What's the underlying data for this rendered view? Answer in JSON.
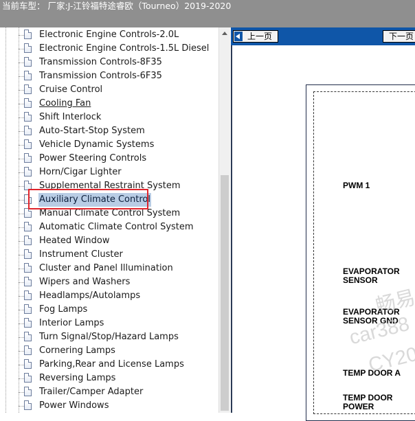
{
  "window": {
    "title": "当前车型：  厂家:J-江铃福特途睿欧（Tourneo）2019-2020"
  },
  "tree": {
    "items": [
      {
        "label": "Electronic Engine Controls-2.0L",
        "state": "normal"
      },
      {
        "label": "Electronic Engine Controls-1.5L Diesel",
        "state": "normal"
      },
      {
        "label": "Transmission Controls-8F35",
        "state": "normal"
      },
      {
        "label": "Transmission Controls-6F35",
        "state": "normal"
      },
      {
        "label": "Cruise Control",
        "state": "normal"
      },
      {
        "label": "Cooling Fan",
        "state": "underline"
      },
      {
        "label": "Shift Interlock",
        "state": "normal"
      },
      {
        "label": "Auto-Start-Stop System",
        "state": "normal"
      },
      {
        "label": "Vehicle Dynamic Systems",
        "state": "normal"
      },
      {
        "label": "Power Steering Controls",
        "state": "normal"
      },
      {
        "label": "Horn/Cigar Lighter",
        "state": "normal"
      },
      {
        "label": "Supplemental Restraint System",
        "state": "normal"
      },
      {
        "label": "Auxiliary Climate Control",
        "state": "selected"
      },
      {
        "label": "Manual Climate Control System",
        "state": "normal"
      },
      {
        "label": "Automatic Climate Control System",
        "state": "normal"
      },
      {
        "label": "Heated Window",
        "state": "normal"
      },
      {
        "label": "Instrument Cluster",
        "state": "normal"
      },
      {
        "label": "Cluster and Panel Illumination",
        "state": "normal"
      },
      {
        "label": "Wipers and Washers",
        "state": "normal"
      },
      {
        "label": "Headlamps/Autolamps",
        "state": "normal"
      },
      {
        "label": "Fog Lamps",
        "state": "normal"
      },
      {
        "label": "Interior Lamps",
        "state": "normal"
      },
      {
        "label": "Turn Signal/Stop/Hazard Lamps",
        "state": "normal"
      },
      {
        "label": "Cornering Lamps",
        "state": "normal"
      },
      {
        "label": "Parking,Rear and License Lamps",
        "state": "normal"
      },
      {
        "label": "Reversing Lamps",
        "state": "normal"
      },
      {
        "label": "Trailer/Camper Adapter",
        "state": "normal"
      },
      {
        "label": "Power Windows",
        "state": "normal"
      }
    ],
    "icon": "document-icon"
  },
  "viewer": {
    "prev_label": "上一页",
    "next_label": "下一页",
    "prev_icon": "arrow-left-icon"
  },
  "diagram": {
    "labels": {
      "pwm1": "PWM 1",
      "evap_sensor": "EVAPORATOR\nSENSOR",
      "evap_sensor_gnd": "EVAPORATOR\nSENSOR GND",
      "temp_door_a": "TEMP DOOR A",
      "temp_door_power": "TEMP DOOR\nPOWER"
    },
    "watermark": {
      "line1": "畅易",
      "line2": "car388",
      "line3": "CY20"
    }
  },
  "colors": {
    "titlebar": "#8f8f8f",
    "viewer_bar": "#0f56a8",
    "selection": "#b9cde5",
    "highlight_box": "#e0242b"
  }
}
